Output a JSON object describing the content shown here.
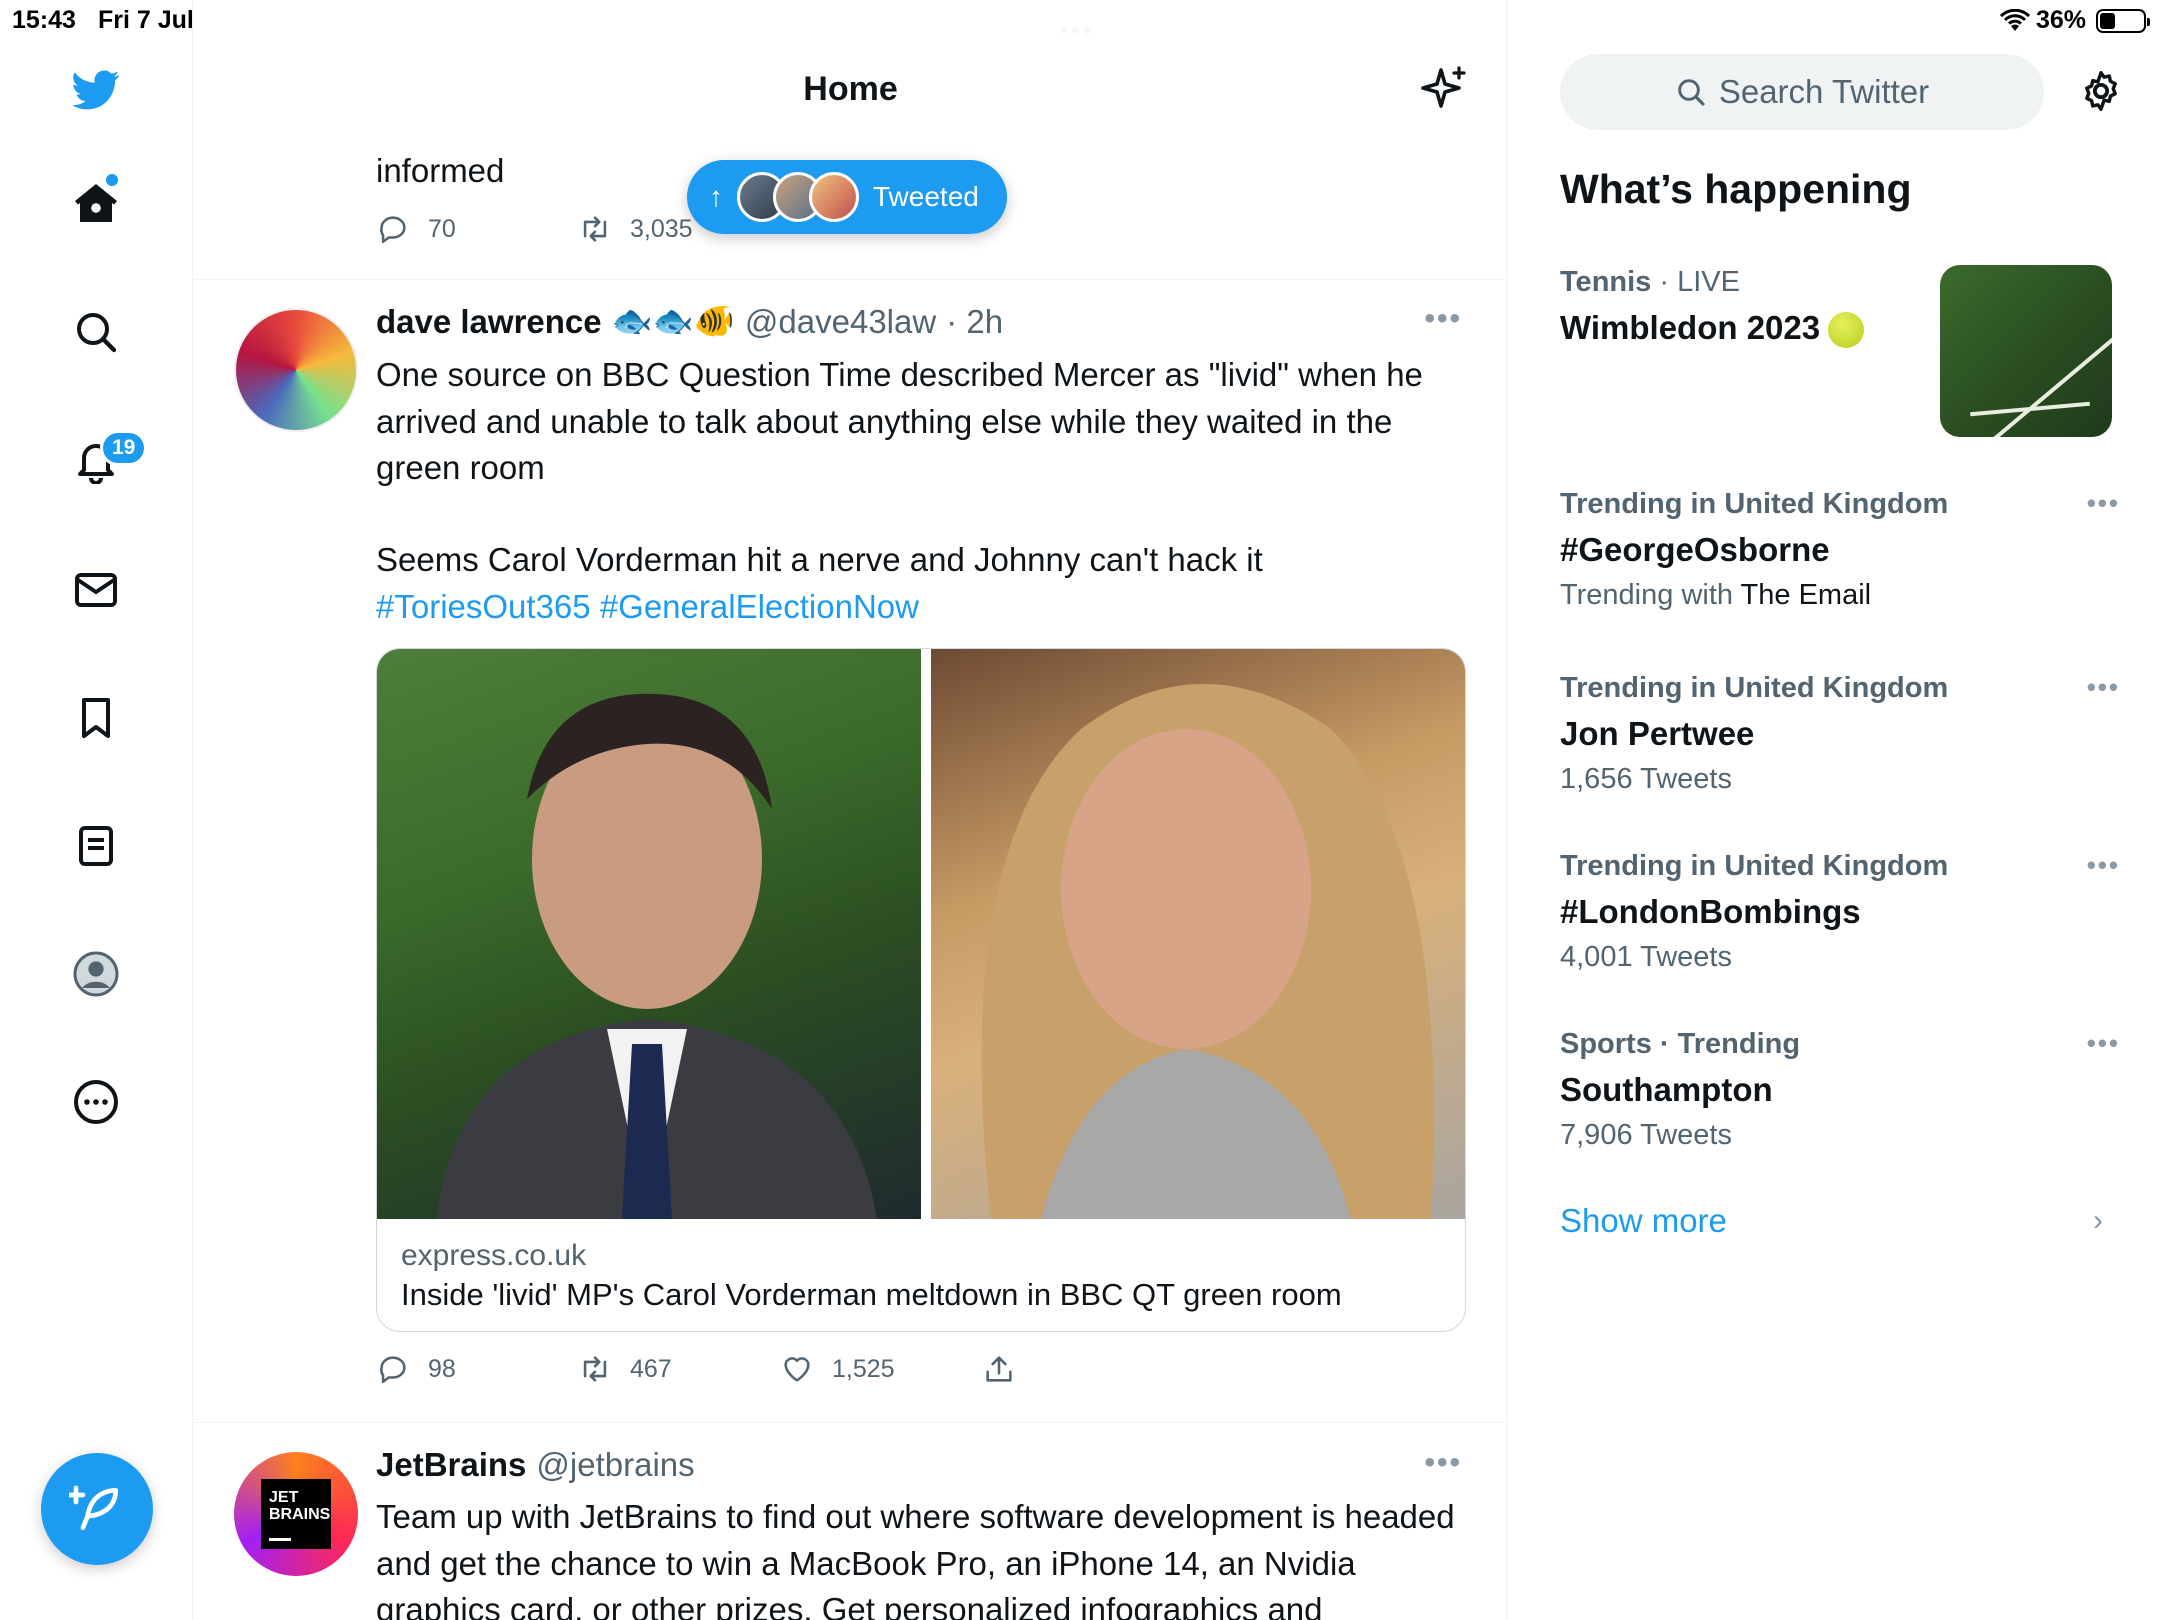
{
  "status_bar": {
    "time": "15:43",
    "date": "Fri 7 Jul",
    "battery": "36%",
    "battery_level": 0.36
  },
  "nav": {
    "notifications_badge": "19"
  },
  "header": {
    "title": "Home"
  },
  "previous_tweet": {
    "text_tail": "informed",
    "replies": "70",
    "retweets": "3,035"
  },
  "new_tweets_pill": {
    "label": "Tweeted"
  },
  "tweet1": {
    "name": "dave lawrence",
    "emoji": "🐟🐟🐠",
    "handle": "@dave43law",
    "time": "· 2h",
    "text1": "One source on BBC Question Time described Mercer as \"livid\" when he arrived and unable to talk about anything else while they waited in the green room",
    "text2": "Seems Carol Vorderman hit a nerve and Johnny can't hack it",
    "hashtag1": "#ToriesOut365",
    "hashtag2": "#GeneralElectionNow",
    "card_domain": "express.co.uk",
    "card_title": "Inside 'livid' MP's Carol Vorderman meltdown in BBC QT green room",
    "replies": "98",
    "retweets": "467",
    "likes": "1,525"
  },
  "tweet2": {
    "name": "JetBrains",
    "handle": "@jetbrains",
    "avatar_text_1": "JET",
    "avatar_text_2": "BRAINS",
    "text": "Team up with JetBrains to find out where software development is headed and get the chance to win a MacBook Pro, an iPhone 14, an Nvidia graphics card, or other prizes. Get personalized infographics and"
  },
  "sidebar": {
    "search_placeholder": "Search Twitter",
    "whats_happening": "What’s happening",
    "trends": [
      {
        "context": "Tennis",
        "context_suffix": " · LIVE",
        "name": "Wimbledon 2023",
        "sub": ""
      },
      {
        "context": "Trending in United Kingdom",
        "name": "#GeorgeOsborne",
        "sub_prefix": "Trending with ",
        "sub_highlight": "The Email"
      },
      {
        "context": "Trending in United Kingdom",
        "name": "Jon Pertwee",
        "sub": "1,656 Tweets"
      },
      {
        "context": "Trending in United Kingdom",
        "name": "#LondonBombings",
        "sub": "4,001 Tweets"
      },
      {
        "context": "Sports · Trending",
        "name": "Southampton",
        "sub": "7,906 Tweets"
      }
    ],
    "show_more": "Show more"
  },
  "colors": {
    "accent": "#1d9bf0",
    "text": "#0f1419",
    "secondary": "#536471"
  }
}
